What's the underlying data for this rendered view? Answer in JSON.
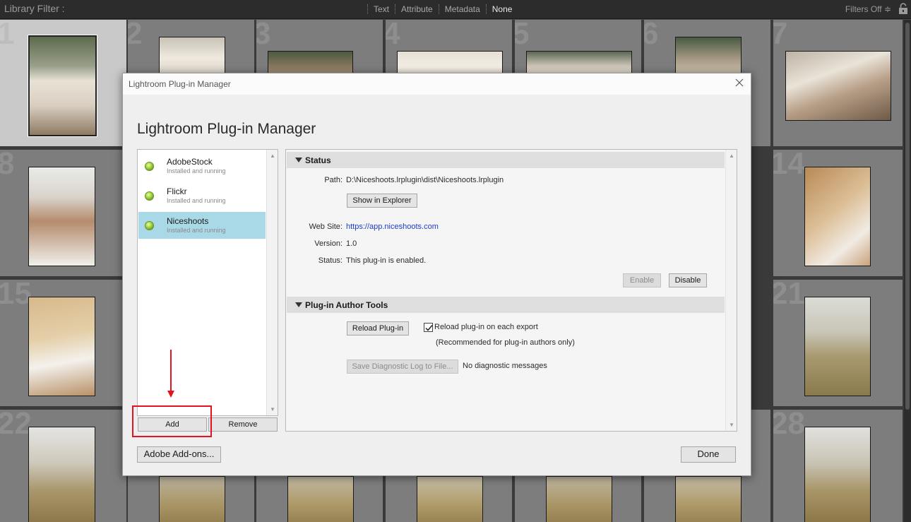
{
  "filter_bar": {
    "title": "Library Filter :",
    "filters": [
      "Text",
      "Attribute",
      "Metadata",
      "None"
    ],
    "active_filter": "None",
    "right_label": "Filters Off ≑"
  },
  "grid": {
    "cell_numbers": [
      "1",
      "2",
      "3",
      "4",
      "5",
      "6",
      "7",
      "8",
      "14",
      "15",
      "21",
      "22",
      "28"
    ]
  },
  "dialog": {
    "window_title": "Lightroom Plug-in Manager",
    "heading": "Lightroom Plug-in Manager",
    "plugins": [
      {
        "name": "AdobeStock",
        "status": "Installed and running"
      },
      {
        "name": "Flickr",
        "status": "Installed and running"
      },
      {
        "name": "Niceshoots",
        "status": "Installed and running"
      }
    ],
    "selected_plugin": "Niceshoots",
    "add_label": "Add",
    "remove_label": "Remove",
    "addons_label": "Adobe Add-ons...",
    "done_label": "Done",
    "status_section": {
      "title": "Status",
      "path_label": "Path:",
      "path_value": "D:\\Niceshoots.lrplugin\\dist\\Niceshoots.lrplugin",
      "show_explorer_label": "Show in Explorer",
      "website_label": "Web Site:",
      "website_value": "https://app.niceshoots.com",
      "version_label": "Version:",
      "version_value": "1.0",
      "status_label": "Status:",
      "status_value": "This plug-in is enabled.",
      "enable_label": "Enable",
      "disable_label": "Disable"
    },
    "author_section": {
      "title": "Plug-in Author Tools",
      "reload_label": "Reload Plug-in",
      "reload_checkbox_label": "Reload plug-in on each export",
      "reload_checkbox_checked": true,
      "recommended_note": "(Recommended for plug-in authors only)",
      "save_log_label": "Save Diagnostic Log to File...",
      "diagnostic_message": "No diagnostic messages"
    }
  },
  "colors": {
    "selection_blue": "#a9d9e6",
    "annotation_red": "#e5131d",
    "link_blue": "#1a3ccc"
  }
}
